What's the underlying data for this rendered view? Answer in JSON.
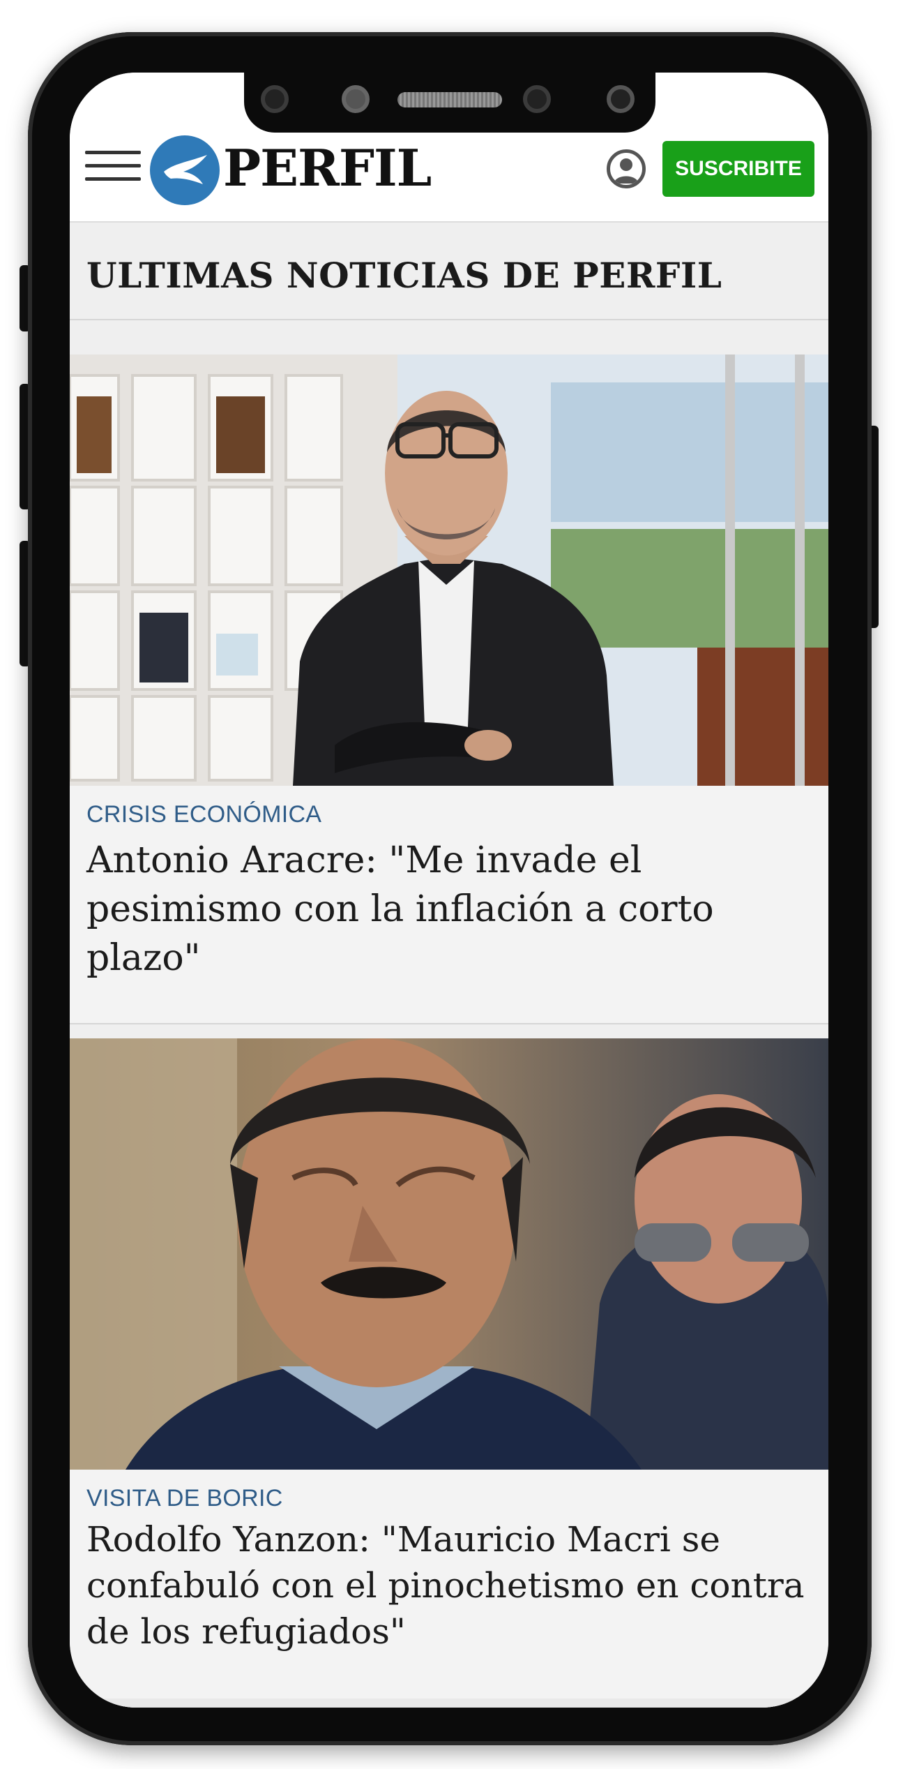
{
  "header": {
    "logo_text": "PERFIL",
    "subscribe_label": "SUSCRIBITE"
  },
  "section": {
    "title": "ULTIMAS NOTICIAS DE PERFIL"
  },
  "articles": [
    {
      "category": "CRISIS ECONÓMICA",
      "headline": "Antonio Aracre: \"Me invade el pesimismo con la inflación a corto plazo\""
    },
    {
      "category": "VISITA DE BORIC",
      "headline": "Rodolfo Yanzon: \"Mauricio Macri se confabuló con el pinochetismo en contra de los refugiados\""
    }
  ],
  "colors": {
    "brand_blue": "#2f7ab8",
    "subscribe_green": "#19a019",
    "category_blue": "#2f5c88"
  },
  "icons": {
    "menu": "hamburger-menu-icon",
    "logo": "bird-logo-icon",
    "user": "user-account-icon"
  }
}
